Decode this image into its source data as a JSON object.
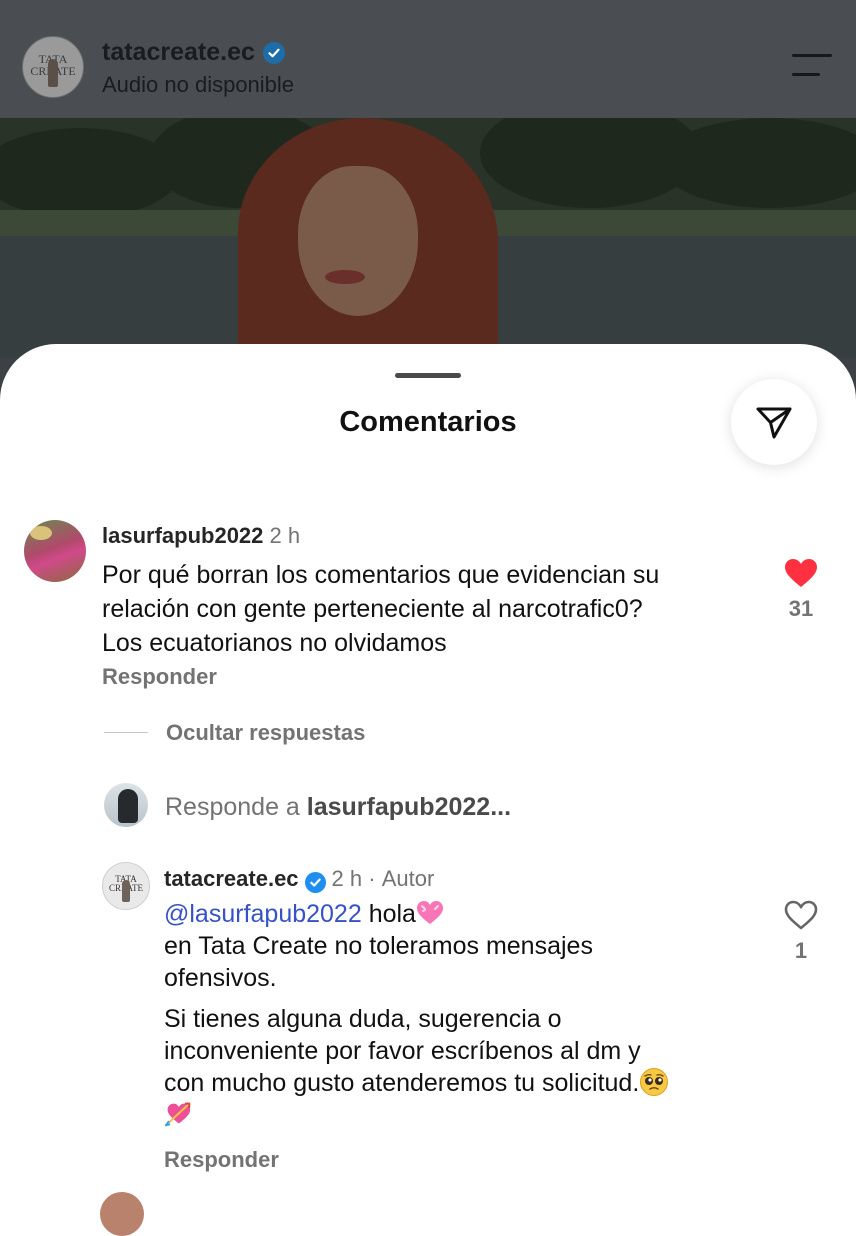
{
  "header": {
    "username": "tatacreate.ec",
    "subtitle": "Audio no disponible",
    "avatar_text": "TATA CREATE"
  },
  "sheet": {
    "title": "Comentarios"
  },
  "comment": {
    "username": "lasurfapub2022",
    "time": "2 h",
    "lines": [
      "Por qué borran los comentarios que evidencian su",
      "relación con gente perteneciente al narcotrafic0?",
      "Los ecuatorianos no olvidamos"
    ],
    "reply_label": "Responder",
    "like_count": "31",
    "liked": true
  },
  "thread": {
    "hide_replies_label": "Ocultar respuestas"
  },
  "reply_box": {
    "placeholder_prefix": "Responde a",
    "placeholder_user": "lasurfapub2022..."
  },
  "reply": {
    "username": "tatacreate.ec",
    "time": "2 h",
    "separator": "·",
    "author_label": "Autor",
    "mention": "@lasurfapub2022",
    "first_line_text": " hola",
    "line2": "en Tata Create no toleramos mensajes",
    "line3": "ofensivos.",
    "line4": "Si tienes alguna duda, sugerencia o",
    "line5": "inconveniente por favor escríbenos al dm y",
    "line6": "con mucho gusto atenderemos tu solicitud.",
    "reply_label": "Responder",
    "like_count": "1",
    "liked": false
  },
  "colors": {
    "like_red": "#ff3040",
    "verified_blue": "#1e8ef0",
    "mention_blue": "#3752c7",
    "secondary_gray": "#737373"
  },
  "icons": {
    "share": "paper-plane-icon",
    "menu": "menu-icon",
    "verified": "verified-badge-icon",
    "like": "heart-icon"
  }
}
